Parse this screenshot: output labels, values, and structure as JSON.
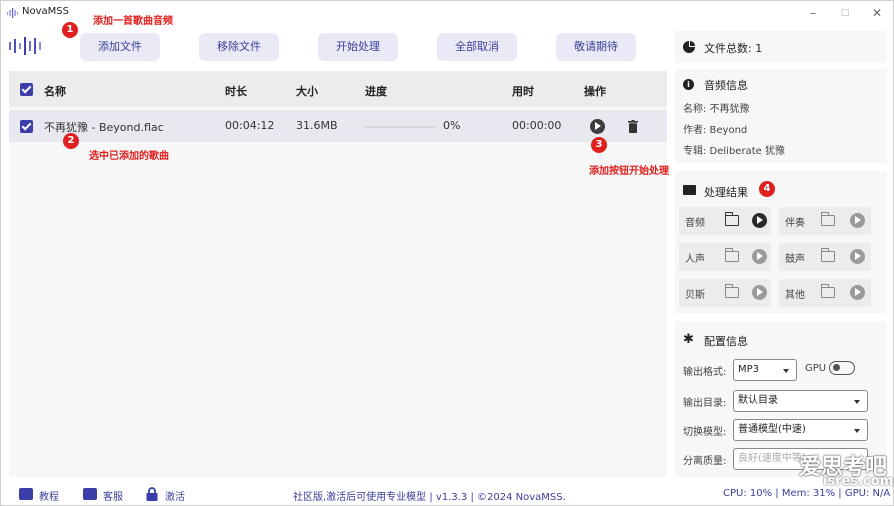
{
  "window": {
    "title": "NovaMSS",
    "minimize": "–",
    "maximize": "□",
    "close": "✕"
  },
  "annotations": {
    "a1": "添加一首歌曲音频",
    "a2": "选中已添加的歌曲",
    "a3": "添加按钮开始处理",
    "b1": "1",
    "b2": "2",
    "b3": "3",
    "b4": "4"
  },
  "toolbar": {
    "add": "添加文件",
    "remove": "移除文件",
    "start": "开始处理",
    "cancel_all": "全部取消",
    "coming": "敬请期待"
  },
  "table": {
    "headers": {
      "name": "名称",
      "duration": "时长",
      "size": "大小",
      "progress": "进度",
      "elapsed": "用时",
      "action": "操作"
    },
    "rows": [
      {
        "name": "不再犹豫 - Beyond.flac",
        "duration": "00:04:12",
        "size": "31.6MB",
        "progress": "0%",
        "elapsed": "00:00:00"
      }
    ]
  },
  "sidebar": {
    "file_count": "文件总数: 1",
    "audio_info": {
      "title": "音频信息",
      "name": "名称:  不再犹豫",
      "author": "作者:  Beyond",
      "album": "专辑:  Deliberate 犹豫"
    },
    "results": {
      "title": "处理结果",
      "cells": [
        {
          "label": "音频"
        },
        {
          "label": "伴奏"
        },
        {
          "label": "人声"
        },
        {
          "label": "鼓声"
        },
        {
          "label": "贝斯"
        },
        {
          "label": "其他"
        }
      ]
    },
    "config": {
      "title": "配置信息",
      "format_label": "输出格式:",
      "format_value": "MP3",
      "gpu_label": "GPU",
      "dir_label": "输出目录:",
      "dir_value": "默认目录",
      "model_label": "切换模型:",
      "model_value": "普通模型(中速)",
      "quality_label": "分离质量:",
      "quality_value": "良好(速度中等)"
    }
  },
  "statusbar": {
    "tutorial": "教程",
    "support": "客服",
    "activate": "激活",
    "center": "社区版,激活后可使用专业模型 | v1.3.3 | ©2024 NovaMSS.",
    "right": "CPU: 10% | Mem: 31% | GPU: N/A"
  },
  "watermark": {
    "line1": "爱思考吧",
    "line2": "isres.com"
  },
  "colors": {
    "accent": "#3b3ea8",
    "annotation": "#e0201e",
    "button_bg": "#e9eaf6"
  }
}
